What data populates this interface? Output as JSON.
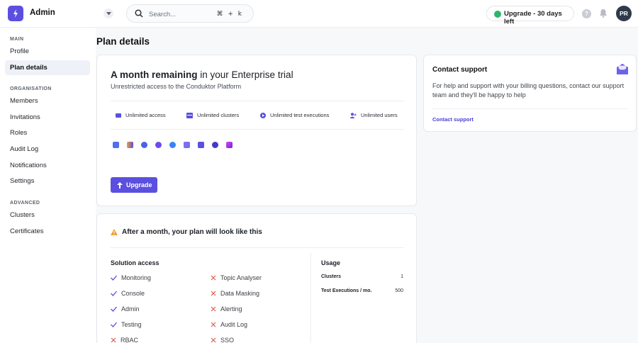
{
  "app": {
    "title": "Admin",
    "logo_icon": "conduktor-logo-icon"
  },
  "search": {
    "placeholder": "Search...",
    "shortcut": "⌘ + k"
  },
  "header": {
    "upgrade_label": "Upgrade - 30 days left",
    "avatar_initials": "PR",
    "help_label": "?"
  },
  "sidebar": {
    "sections": [
      {
        "label": "MAIN",
        "items": [
          "Profile",
          "Plan details"
        ]
      },
      {
        "label": "ORGANISATION",
        "items": [
          "Members",
          "Invitations",
          "Roles",
          "Audit Log",
          "Notifications",
          "Settings"
        ]
      },
      {
        "label": "ADVANCED",
        "items": [
          "Clusters",
          "Certificates"
        ]
      }
    ],
    "active_item": "Plan details"
  },
  "main": {
    "page_title": "Plan details",
    "plan": {
      "headline_bold": "A month remaining",
      "headline_rest": " in your Enterprise trial",
      "subtitle": "Unrestricted access to the Conduktor Platform",
      "features": [
        "Unlimited access",
        "Unlimited clusters",
        "Unlimited test executions",
        "Unlimited users"
      ],
      "upgrade_button": "Upgrade"
    },
    "after": {
      "title": "After a month, your plan will look like this",
      "solution_heading": "Solution access",
      "included": [
        "Monitoring",
        "Console",
        "Admin",
        "Testing"
      ],
      "excluded_col1": [
        "RBAC"
      ],
      "excluded_col2": [
        "Topic Analyser",
        "Data Masking",
        "Alerting",
        "Audit Log",
        "SSO"
      ],
      "usage_heading": "Usage",
      "usage": [
        {
          "label": "Clusters",
          "value": "1"
        },
        {
          "label": "Test Executions / mo.",
          "value": "500"
        }
      ]
    },
    "support": {
      "title": "Contact support",
      "text": "For help and support with your billing questions, contact our support team and they'll be happy to help",
      "link": "Contact support"
    }
  },
  "colors": {
    "accent": "#5b4fe0",
    "success": "#2fb46b",
    "warning": "#f0a030",
    "danger": "#e05a4a"
  }
}
